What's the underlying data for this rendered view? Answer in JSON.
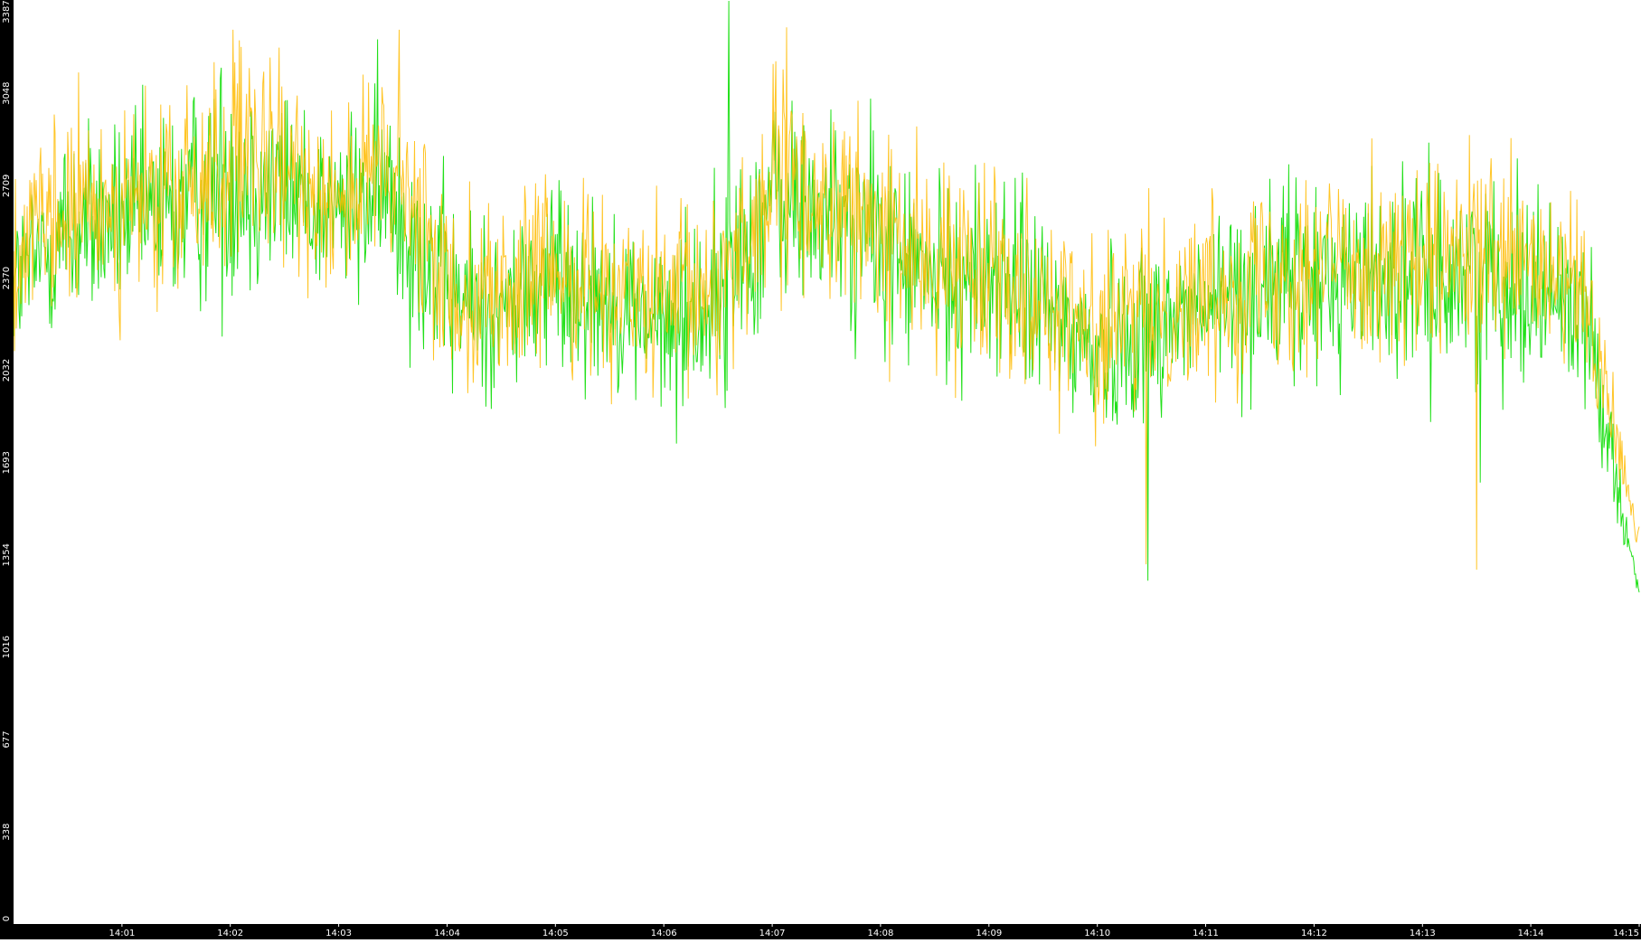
{
  "chart_data": {
    "type": "line",
    "title": "",
    "xlabel": "",
    "ylabel": "",
    "ylim": [
      0,
      3387
    ],
    "xlim": [
      "14:00:00",
      "14:15:00"
    ],
    "grid": false,
    "legend": "none",
    "y_ticks": [
      "0",
      "338",
      "677",
      "1016",
      "1354",
      "1693",
      "2032",
      "2370",
      "2709",
      "3048",
      "3387"
    ],
    "x_ticks": [
      "14:01",
      "14:02",
      "14:03",
      "14:04",
      "14:05",
      "14:06",
      "14:07",
      "14:08",
      "14:09",
      "14:10",
      "14:11",
      "14:12",
      "14:13",
      "14:14",
      "14:15"
    ],
    "colors": {
      "background": "#ffffff",
      "axis": "#000000",
      "tick_text": "#ffffff",
      "green": "#22e01a",
      "orange": "#ffbb00"
    },
    "series": [
      {
        "color": "#22e01a",
        "x": [
          "14:00:00",
          "14:00:30",
          "14:01:00",
          "14:01:30",
          "14:02:00",
          "14:02:30",
          "14:03:00",
          "14:03:30",
          "14:04:00",
          "14:04:30",
          "14:05:00",
          "14:05:30",
          "14:06:00",
          "14:06:30",
          "14:07:00",
          "14:07:30",
          "14:08:00",
          "14:08:30",
          "14:09:00",
          "14:09:30",
          "14:10:00",
          "14:10:30",
          "14:11:00",
          "14:11:30",
          "14:12:00",
          "14:12:30",
          "14:13:00",
          "14:13:30",
          "14:14:00",
          "14:14:30",
          "14:15:00"
        ],
        "values": [
          2350,
          2550,
          2580,
          2620,
          2750,
          2700,
          2620,
          2680,
          2300,
          2250,
          2380,
          2300,
          2180,
          2300,
          2650,
          2600,
          2500,
          2350,
          2400,
          2250,
          2100,
          2200,
          2250,
          2350,
          2350,
          2400,
          2350,
          2400,
          2350,
          2250,
          1200
        ],
        "noise": [
          0.028,
          0.035,
          0.03,
          0.034,
          0.038,
          0.03,
          0.027,
          0.035,
          0.036,
          0.032,
          0.037,
          0.03,
          0.034,
          0.04,
          0.035,
          0.031,
          0.035,
          0.032,
          0.037,
          0.036,
          0.038,
          0.033,
          0.035,
          0.034,
          0.036,
          0.034,
          0.036,
          0.033,
          0.035,
          0.032,
          0.01
        ],
        "spikes": [
          {
            "x": "14:06:36",
            "value": 3387
          },
          {
            "x": "14:10:28",
            "value": 1260
          },
          {
            "x": "14:13:32",
            "value": 1620
          }
        ]
      },
      {
        "color": "#ffbb00",
        "x": [
          "14:00:00",
          "14:00:30",
          "14:01:00",
          "14:01:30",
          "14:02:00",
          "14:02:30",
          "14:03:00",
          "14:03:30",
          "14:04:00",
          "14:04:30",
          "14:05:00",
          "14:05:30",
          "14:06:00",
          "14:06:30",
          "14:07:00",
          "14:07:30",
          "14:08:00",
          "14:08:30",
          "14:09:00",
          "14:09:30",
          "14:10:00",
          "14:10:30",
          "14:11:00",
          "14:11:30",
          "14:12:00",
          "14:12:30",
          "14:13:00",
          "14:13:30",
          "14:14:00",
          "14:14:30",
          "14:15:00"
        ],
        "values": [
          2450,
          2600,
          2650,
          2650,
          2800,
          2750,
          2680,
          2750,
          2350,
          2300,
          2400,
          2350,
          2250,
          2350,
          2700,
          2650,
          2550,
          2400,
          2450,
          2300,
          2150,
          2250,
          2300,
          2400,
          2420,
          2450,
          2400,
          2450,
          2400,
          2300,
          1400
        ],
        "noise": [
          0.03,
          0.032,
          0.03,
          0.033,
          0.035,
          0.03,
          0.028,
          0.036,
          0.034,
          0.032,
          0.034,
          0.03,
          0.034,
          0.038,
          0.034,
          0.03,
          0.034,
          0.031,
          0.034,
          0.034,
          0.036,
          0.032,
          0.034,
          0.033,
          0.035,
          0.033,
          0.035,
          0.032,
          0.034,
          0.031,
          0.01
        ],
        "spikes": [
          {
            "x": "14:07:08",
            "value": 3290
          },
          {
            "x": "14:10:27",
            "value": 1320
          },
          {
            "x": "14:13:30",
            "value": 1300
          }
        ]
      }
    ]
  }
}
